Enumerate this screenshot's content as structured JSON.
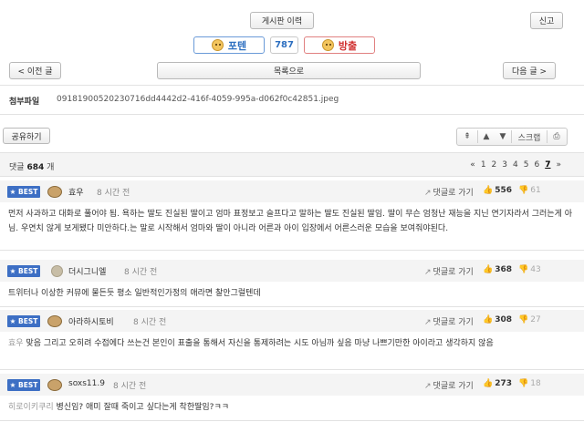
{
  "header": {
    "history_label": "게시판 이력",
    "report_label": "신고"
  },
  "votes": {
    "up_label": "포텐",
    "count": "787",
    "down_label": "방출"
  },
  "nav": {
    "prev_label": "< 이전 글",
    "list_label": "목록으로",
    "next_label": "다음 글 >"
  },
  "attachment": {
    "label": "첨부파일",
    "filename": "09181900520230716dd4442d2-416f-4059-995a-d062f0c42851.jpeg"
  },
  "share_label": "공유하기",
  "toolbar": {
    "scrap_label": "스크랩",
    "icons": [
      "arrow-up-double",
      "arrow-up",
      "arrow-down",
      "scrap",
      "print"
    ]
  },
  "comments_header": {
    "prefix": "댓글",
    "count": "684",
    "suffix": "개",
    "pages": [
      "«",
      "1",
      "2",
      "3",
      "4",
      "5",
      "6",
      "7",
      "»"
    ],
    "current_page": "7"
  },
  "comments": [
    {
      "badge": "BEST",
      "nick": "효우",
      "time": "8 시간 전",
      "reply_label": "댓글로 가기",
      "likes": "556",
      "dislikes": "61",
      "body_prefix": "",
      "body": "먼저 사과하고 대화로 풀어야 됨. 욕하는 딸도 진실된 딸이고 엄마 표정보고 슬프다고 말하는 딸도 진실된 딸임. 딸이 무슨 엄청난 재능을 지닌 연기자라서 그러는게 아님. 우연치 않게 보게됐다 미안하다.는 말로 시작해서 엄마와 딸이 아니라 어른과 아이 입장에서 어른스러운 모습을 보여줘야된다."
    },
    {
      "badge": "BEST",
      "nick": "더시그니엘",
      "time": "8 시간 전",
      "reply_label": "댓글로 가기",
      "likes": "368",
      "dislikes": "43",
      "body_prefix": "",
      "body": "트위터나 이상한 커뮤에 물든듯 평소 일반적인가정의 애라면 찰안그럴텐데"
    },
    {
      "badge": "BEST",
      "nick": "아라하시토비",
      "time": "8 시간 전",
      "reply_label": "댓글로 가기",
      "likes": "308",
      "dislikes": "27",
      "body_prefix": "효우",
      "body": "맞음 그리고 오히려 수접에다 쓰는건 본인이 표출을 통해서 자신을 통제하려는 시도 아님까 싶음 마냥 나쁘기만한 아이라고 생각하지 않음"
    },
    {
      "badge": "BEST",
      "nick": "soxs11.9",
      "time": "8 시간 전",
      "reply_label": "댓글로 가기",
      "likes": "273",
      "dislikes": "18",
      "body_prefix": "히로이키쿠리",
      "body": "병신임? 애미 잘때 죽이고 싶다는게 착한딸임?ㅋㅋ"
    }
  ],
  "colors": {
    "best_badge": "#3d6fc4",
    "vote_up": "#2d6fc0",
    "vote_down": "#d03030"
  }
}
